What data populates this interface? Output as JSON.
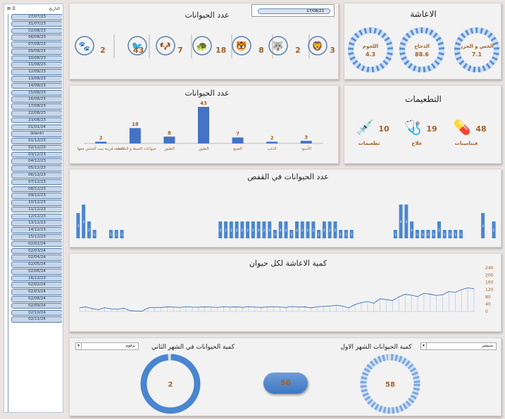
{
  "slicer": {
    "header": "التاريخ",
    "items": [
      "27/07/23",
      "31/07/23",
      "02/08/23",
      "06/08/23",
      "07/08/23",
      "09/08/23",
      "10/08/23",
      "11/08/23",
      "12/08/23",
      "13/08/23",
      "14/08/23",
      "15/08/23",
      "16/08/23",
      "17/08/23",
      "22/08/23",
      "23/08/23",
      "01/01/24",
      "(blank)",
      "01/12/23",
      "02/12/23",
      "03/12/23",
      "04/12/23",
      "05/12/23",
      "06/12/23",
      "07/12/23",
      "08/12/23",
      "09/12/23",
      "10/12/23",
      "11/12/23",
      "12/12/23",
      "13/12/23",
      "14/12/23",
      "15/12/23",
      "02/01/24",
      "02/03/24",
      "02/04/24",
      "02/05/24",
      "02/06/24",
      "16/12/23",
      "02/02/24",
      "02/03/24",
      "02/08/24",
      "02/09/24",
      "02/10/24",
      "02/11/24"
    ]
  },
  "top_counts": {
    "title": "عدد الحيوانات",
    "date_value": "17/08/23",
    "values": [
      "2",
      "43",
      "7",
      "18",
      "8",
      "2",
      "3"
    ]
  },
  "feeding": {
    "title": "الاعاشة",
    "donuts": [
      {
        "label": "الخس و الجزر",
        "value": "7.1"
      },
      {
        "label": "الدجاج",
        "value": "88.6"
      },
      {
        "label": "اللحوم",
        "value": "4.3"
      }
    ]
  },
  "vaccines": {
    "title": "التطعيمات",
    "items": [
      {
        "label": "فيتامينات",
        "value": "48"
      },
      {
        "label": "علاج",
        "value": "19"
      },
      {
        "label": "تطعيمات",
        "value": "10"
      }
    ]
  },
  "chart_bar": {
    "title": "عدد الحيوانات",
    "categories": [
      "كلمات قريبة بيب الحنش معها",
      "حيوانات الحيط و السلاحف",
      "الطيور",
      "الطيور",
      "الضبع",
      "الذئب",
      "الأسود"
    ],
    "values": [
      2,
      18,
      8,
      43,
      7,
      2,
      3
    ]
  },
  "chart_cage": {
    "title": "عدد الحيوانات  في القفص",
    "values": [
      3,
      4,
      2,
      1,
      0,
      0,
      1,
      1,
      1,
      0,
      0,
      0,
      0,
      0,
      0,
      0,
      0,
      0,
      0,
      0,
      0,
      0,
      0,
      0,
      0,
      0,
      2,
      2,
      2,
      2,
      2,
      2,
      2,
      2,
      2,
      2,
      1,
      2,
      2,
      1,
      2,
      2,
      2,
      2,
      1,
      2,
      2,
      2,
      1,
      1,
      1,
      0,
      0,
      0,
      0,
      0,
      0,
      0,
      1,
      4,
      4,
      2,
      1,
      1,
      1,
      1,
      2,
      1,
      1,
      1,
      1,
      0,
      0,
      0,
      3,
      0,
      2
    ]
  },
  "chart_line": {
    "title": "كمية الاعاشة لكل حيوان",
    "ylim": [
      0,
      240
    ],
    "yticks": [
      "240",
      "200",
      "160",
      "120",
      "80",
      "40",
      "0"
    ],
    "values": [
      20,
      25,
      15,
      10,
      20,
      15,
      12,
      18,
      5,
      2,
      2,
      20,
      22,
      22,
      25,
      24,
      22,
      26,
      24,
      23,
      25,
      24,
      22,
      26,
      24,
      25,
      23,
      26,
      24,
      22,
      25,
      26,
      24,
      22,
      28,
      24,
      25,
      20,
      26,
      28,
      30,
      34,
      30,
      20,
      38,
      48,
      55,
      45,
      70,
      65,
      60,
      80,
      95,
      90,
      82,
      100,
      95,
      88,
      92,
      110,
      105,
      120,
      130,
      125
    ]
  },
  "bottom": {
    "left_title": "كمية الحيوانات في الشهر الثاني",
    "right_title": "كمية الحيوانات الشهر الاول",
    "left_dropdown": "برقوم",
    "right_dropdown": "سبتمبر",
    "left_value": "2",
    "right_value": "58",
    "center_value": "56"
  },
  "chart_data": [
    {
      "type": "bar",
      "title": "عدد الحيوانات",
      "categories": [
        "كلمات قريبة بيب الحنش معها",
        "حيوانات الحيط و السلاحف",
        "الطيور",
        "الطيور",
        "الضبع",
        "الذئب",
        "الأسود"
      ],
      "values": [
        2,
        18,
        8,
        43,
        7,
        2,
        3
      ]
    },
    {
      "type": "bar",
      "title": "عدد الحيوانات  في القفص",
      "values": [
        3,
        4,
        2,
        1,
        0,
        0,
        1,
        1,
        1,
        0,
        0,
        0,
        0,
        0,
        0,
        0,
        0,
        0,
        0,
        0,
        0,
        0,
        0,
        0,
        0,
        0,
        2,
        2,
        2,
        2,
        2,
        2,
        2,
        2,
        2,
        2,
        1,
        2,
        2,
        1,
        2,
        2,
        2,
        2,
        1,
        2,
        2,
        2,
        1,
        1,
        1,
        0,
        0,
        0,
        0,
        0,
        0,
        0,
        1,
        4,
        4,
        2,
        1,
        1,
        1,
        1,
        2,
        1,
        1,
        1,
        1,
        0,
        0,
        0,
        3,
        0,
        2
      ]
    },
    {
      "type": "line",
      "title": "كمية الاعاشة لكل حيوان",
      "ylim": [
        0,
        240
      ],
      "values": [
        20,
        25,
        15,
        10,
        20,
        15,
        12,
        18,
        5,
        2,
        2,
        20,
        22,
        22,
        25,
        24,
        22,
        26,
        24,
        23,
        25,
        24,
        22,
        26,
        24,
        25,
        23,
        26,
        24,
        22,
        25,
        26,
        24,
        22,
        28,
        24,
        25,
        20,
        26,
        28,
        30,
        34,
        30,
        20,
        38,
        48,
        55,
        45,
        70,
        65,
        60,
        80,
        95,
        90,
        82,
        100,
        95,
        88,
        92,
        110,
        105,
        120,
        130,
        125
      ]
    },
    {
      "type": "pie",
      "title": "الاعاشة",
      "categories": [
        "الخس و الجزر",
        "الدجاج",
        "اللحوم"
      ],
      "values": [
        7.1,
        88.6,
        4.3
      ]
    }
  ]
}
